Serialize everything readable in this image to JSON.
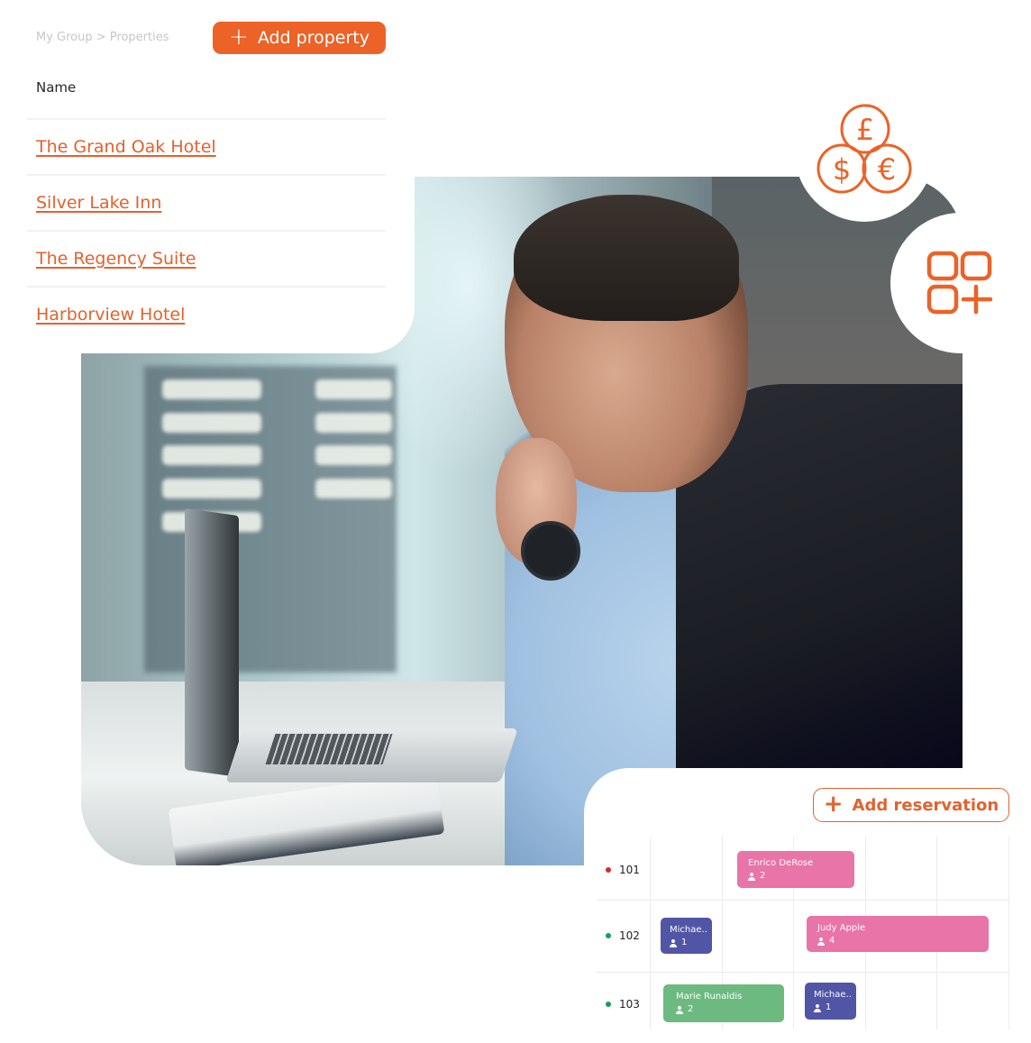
{
  "colors": {
    "accent": "#ec6227",
    "link": "#e4612c",
    "booking_pink": "#e874a8",
    "booking_indigo": "#5055a6",
    "booking_green": "#6cba80",
    "status_red": "#e0242b",
    "status_green": "#13a05a"
  },
  "properties": {
    "breadcrumb": "My Group > Properties",
    "add_button_label": "Add property",
    "add_button_icon": "plus-icon",
    "column_header": "Name",
    "items": [
      {
        "name": "The Grand Oak Hotel"
      },
      {
        "name": "Silver Lake Inn"
      },
      {
        "name": "The Regency Suite"
      },
      {
        "name": "Harborview Hotel"
      }
    ]
  },
  "feature_icons": [
    {
      "name": "currency-coins-icon",
      "glyphs": [
        "£",
        "$",
        "€"
      ]
    },
    {
      "name": "apps-add-icon"
    }
  ],
  "photo": {
    "description": "smiling man with beard working on a laptop at a desk"
  },
  "reservations": {
    "add_button_label": "Add reservation",
    "add_button_icon": "plus-icon",
    "rooms": [
      {
        "number": "101",
        "status": "red"
      },
      {
        "number": "102",
        "status": "green"
      },
      {
        "number": "103",
        "status": "green"
      }
    ],
    "bookings": [
      {
        "guest": "Enrico DeRose",
        "guests": "2",
        "room": "101",
        "color": "pink"
      },
      {
        "guest": "Michae..",
        "guests": "1",
        "room": "102",
        "color": "indigo"
      },
      {
        "guest": "Judy Apple",
        "guests": "4",
        "room": "102",
        "color": "pink"
      },
      {
        "guest": "Marie Runaldis",
        "guests": "2",
        "room": "103",
        "color": "green"
      },
      {
        "guest": "Michae..",
        "guests": "1",
        "room": "103",
        "color": "indigo"
      }
    ]
  }
}
